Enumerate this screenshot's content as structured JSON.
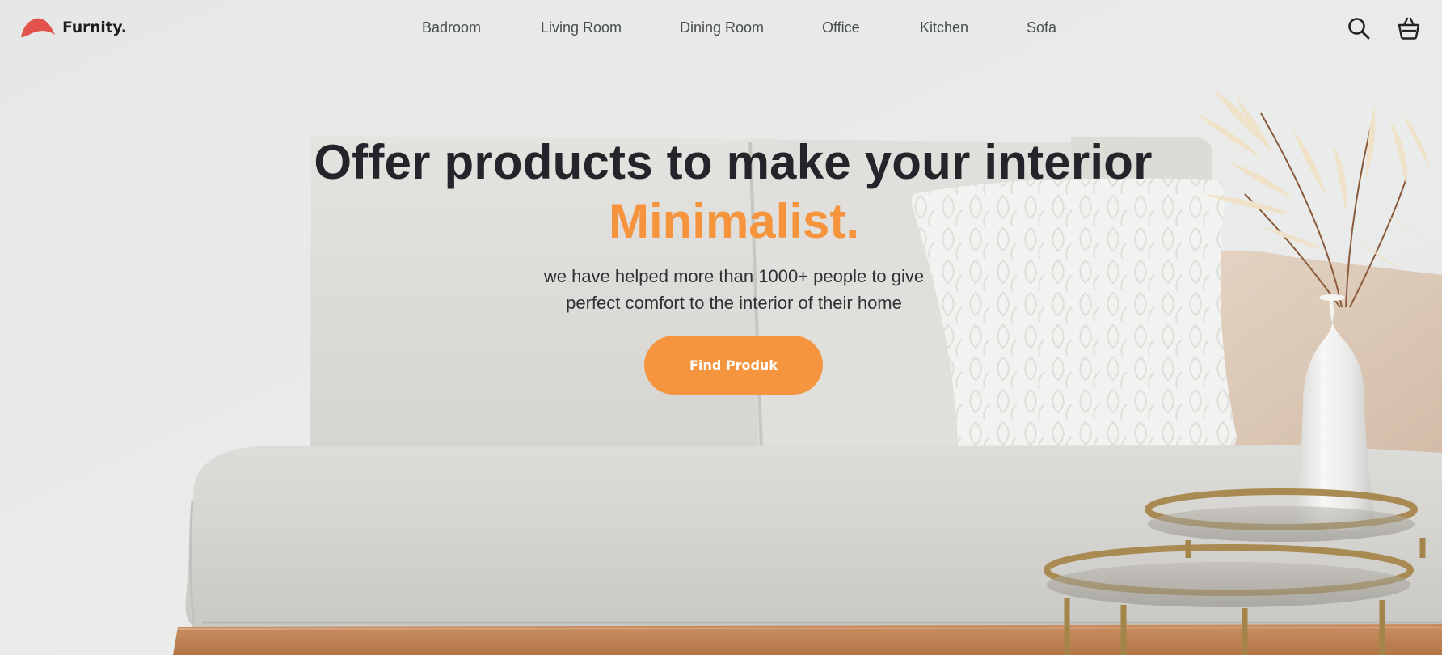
{
  "brand": {
    "name": "Furnity."
  },
  "nav": {
    "items": [
      {
        "label": "Badroom"
      },
      {
        "label": "Living Room"
      },
      {
        "label": "Dining Room"
      },
      {
        "label": "Office"
      },
      {
        "label": "Kitchen"
      },
      {
        "label": "Sofa"
      }
    ]
  },
  "header_actions": {
    "search_icon": "search-icon",
    "cart_icon": "basket-icon"
  },
  "hero": {
    "title": "Offer products to make your interior",
    "highlight": "Minimalist.",
    "subtitle_line1": "we have helped more than 1000+ people to give",
    "subtitle_line2": "perfect comfort to the interior of their home",
    "cta_label": "Find Produk"
  },
  "colors": {
    "accent": "#f6953f",
    "logo": "#e3534c",
    "heading": "#23252a",
    "nav_text": "#4a4d50"
  }
}
